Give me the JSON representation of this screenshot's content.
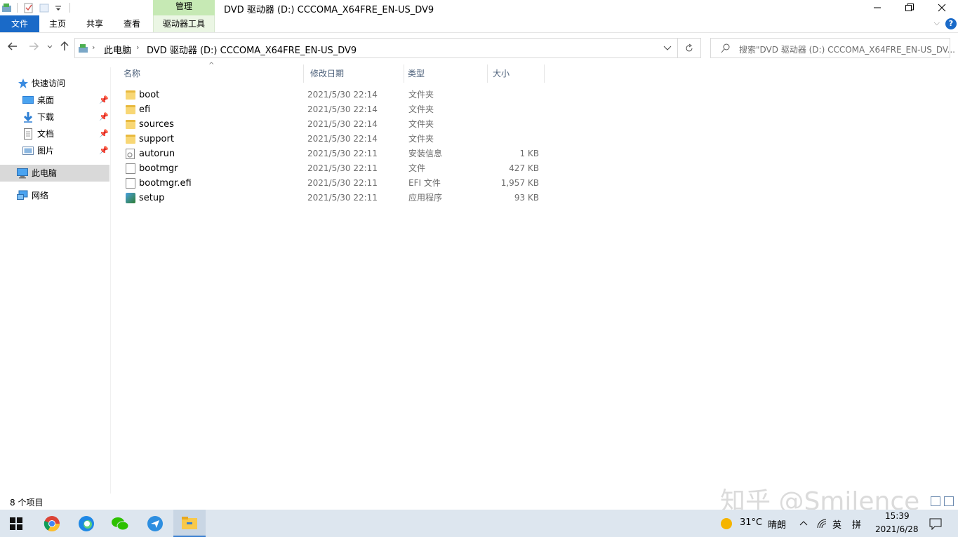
{
  "window": {
    "title": "DVD 驱动器 (D:) CCCOMA_X64FRE_EN-US_DV9",
    "manage_tab": "管理",
    "minimize": "—",
    "maximize": "❐",
    "close": "✕"
  },
  "ribbon": {
    "tabs": [
      "文件",
      "主页",
      "共享",
      "查看",
      "驱动器工具"
    ],
    "help": "?"
  },
  "address": {
    "breadcrumb": [
      "此电脑",
      "DVD 驱动器 (D:) CCCOMA_X64FRE_EN-US_DV9"
    ],
    "search_placeholder": "搜索\"DVD 驱动器 (D:) CCCOMA_X64FRE_EN-US_DV..."
  },
  "navpane": {
    "quick_access": "快速访问",
    "items": [
      "桌面",
      "下载",
      "文档",
      "图片"
    ],
    "this_pc": "此电脑",
    "network": "网络"
  },
  "columns": {
    "name": "名称",
    "date": "修改日期",
    "type": "类型",
    "size": "大小"
  },
  "files": [
    {
      "name": "boot",
      "date": "2021/5/30 22:14",
      "type": "文件夹",
      "size": "",
      "icon": "folder-icon"
    },
    {
      "name": "efi",
      "date": "2021/5/30 22:14",
      "type": "文件夹",
      "size": "",
      "icon": "folder-icon"
    },
    {
      "name": "sources",
      "date": "2021/5/30 22:14",
      "type": "文件夹",
      "size": "",
      "icon": "folder-icon"
    },
    {
      "name": "support",
      "date": "2021/5/30 22:14",
      "type": "文件夹",
      "size": "",
      "icon": "folder-icon"
    },
    {
      "name": "autorun",
      "date": "2021/5/30 22:11",
      "type": "安装信息",
      "size": "1 KB",
      "icon": "settings-file-icon"
    },
    {
      "name": "bootmgr",
      "date": "2021/5/30 22:11",
      "type": "文件",
      "size": "427 KB",
      "icon": "file-icon"
    },
    {
      "name": "bootmgr.efi",
      "date": "2021/5/30 22:11",
      "type": "EFI 文件",
      "size": "1,957 KB",
      "icon": "file-icon"
    },
    {
      "name": "setup",
      "date": "2021/5/30 22:11",
      "type": "应用程序",
      "size": "93 KB",
      "icon": "setup-icon"
    }
  ],
  "status": {
    "item_count": "8 个项目"
  },
  "watermark": "知乎 @Smilence",
  "taskbar": {
    "weather_temp": "31°C",
    "weather_desc": "晴朗",
    "ime_lang": "英",
    "ime_mode": "拼",
    "time": "15:39",
    "date": "2021/6/28"
  },
  "colors": {
    "accent": "#1a6ac8",
    "manage_tab": "#c6e9b4",
    "selected_nav": "#d9d9d9",
    "taskbar": "#dde6ef"
  }
}
